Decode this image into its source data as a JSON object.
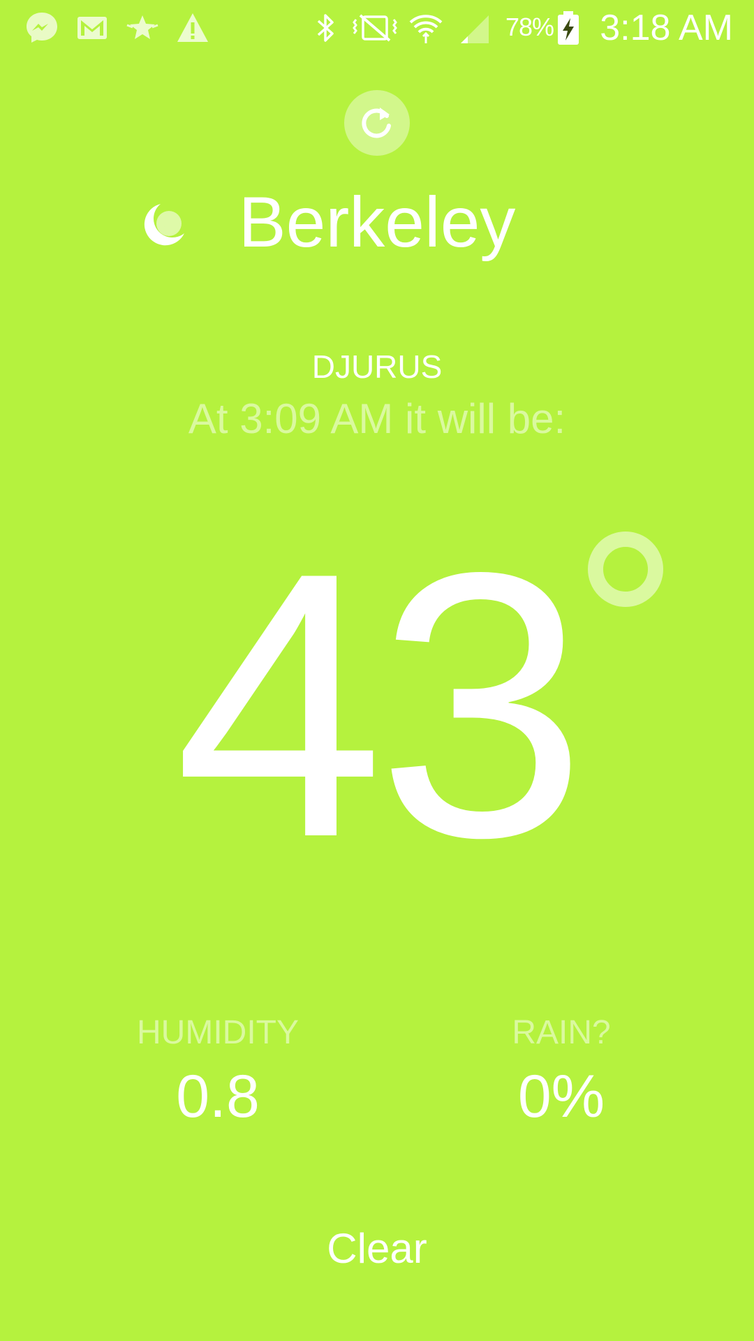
{
  "status_bar": {
    "icons": [
      "messenger-icon",
      "gmail-icon",
      "star-icon",
      "warning-icon",
      "bluetooth-icon",
      "vibrate-icon",
      "wifi-icon",
      "signal-icon",
      "battery-charging-icon"
    ],
    "battery_percent": "78%",
    "time": "3:18 AM"
  },
  "header": {
    "refresh_icon": "refresh-icon",
    "condition_icon": "moon-icon",
    "city": "Berkeley"
  },
  "station": {
    "name": "DJURUS",
    "forecast_caption": "At 3:09 AM it will be:"
  },
  "current": {
    "temperature": "43"
  },
  "stats": {
    "humidity_label": "HUMIDITY",
    "humidity_value": "0.8",
    "rain_label": "RAIN?",
    "rain_value": "0%"
  },
  "summary": "Clear",
  "colors": {
    "background": "#b5f23e",
    "text": "#ffffff",
    "muted_text": "rgba(255,255,255,0.5)"
  }
}
